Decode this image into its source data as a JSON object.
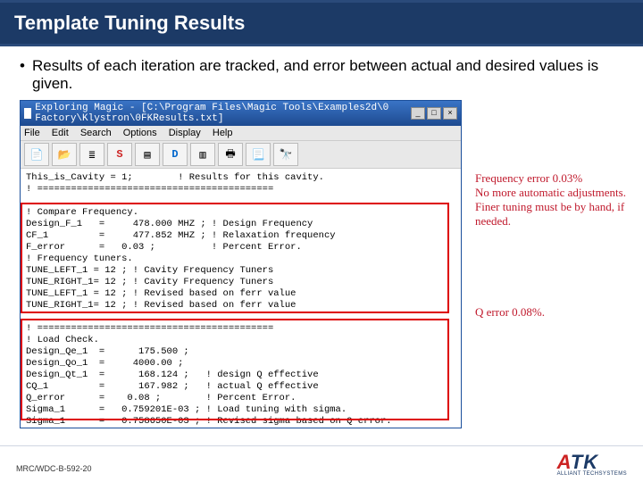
{
  "title": "Template Tuning Results",
  "bullet_text": "Results of each iteration are tracked, and error between actual and desired values is given.",
  "window": {
    "caption": "Exploring Magic - [C:\\Program Files\\Magic Tools\\Examples2d\\0  Factory\\Klystron\\0FKResults.txt]",
    "menus": [
      "File",
      "Edit",
      "Search",
      "Options",
      "Display",
      "Help"
    ],
    "tool_icons": [
      "file-icon",
      "open-icon",
      "list-icon",
      "s-badge-icon",
      "bars-icon",
      "d-badge-icon",
      "bars2-icon",
      "print-icon",
      "page-icon",
      "binoculars-icon"
    ],
    "ctrl_min": "_",
    "ctrl_max": "□",
    "ctrl_close": "×",
    "text_lines": [
      "This_is_Cavity = 1;        ! Results for this cavity.",
      "! ==========================================",
      "",
      "! Compare Frequency.",
      "Design_F_1   =     478.000 MHZ ; ! Design Frequency",
      "CF_1         =     477.852 MHZ ; ! Relaxation frequency",
      "F_error      =   0.03 ;          ! Percent Error.",
      "! Frequency tuners.",
      "TUNE_LEFT_1 = 12 ; ! Cavity Frequency Tuners",
      "TUNE_RIGHT_1= 12 ; ! Cavity Frequency Tuners",
      "TUNE_LEFT_1 = 12 ; ! Revised based on ferr value",
      "TUNE_RIGHT_1= 12 ; ! Revised based on ferr value",
      "",
      "! ==========================================",
      "! Load Check.",
      "Design_Qe_1  =      175.500 ;",
      "Design_Qo_1  =     4000.00 ;",
      "Design_Qt_1  =      168.124 ;   ! design Q effective",
      "CQ_1         =      167.982 ;   ! actual Q effective",
      "Q_error      =    0.08 ;        ! Percent Error.",
      "Sigma_1      =   0.759201E-03 ; ! Load tuning with sigma.",
      "Sigma_1      =   0.758650E-03 ; ! Revised sigma based on Q error."
    ]
  },
  "annotations": {
    "freq": "Frequency error 0.03%\nNo more automatic adjustments.  Finer tuning must be by hand, if needed.",
    "q": "Q error 0.08%."
  },
  "footer": "MRC/WDC-B-592-20",
  "logo": {
    "name_prefix": "A",
    "name_rest": "TK",
    "sub": "ALLIANT TECHSYSTEMS"
  }
}
